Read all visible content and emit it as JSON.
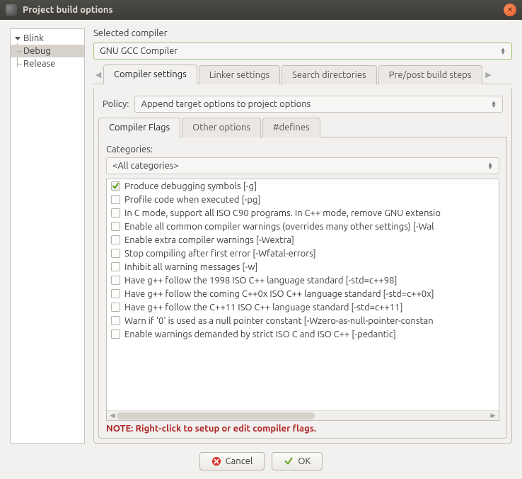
{
  "window": {
    "title": "Project build options"
  },
  "tree": {
    "root": "Blink",
    "children": [
      "Debug",
      "Release"
    ],
    "selected": "Debug"
  },
  "compiler_section": {
    "label": "Selected compiler",
    "value": "GNU GCC Compiler"
  },
  "main_tabs": {
    "items": [
      "Compiler settings",
      "Linker settings",
      "Search directories",
      "Pre/post build steps"
    ],
    "active": 0
  },
  "policy": {
    "label": "Policy:",
    "value": "Append target options to project options"
  },
  "sub_tabs": {
    "items": [
      "Compiler Flags",
      "Other options",
      "#defines"
    ],
    "active": 0
  },
  "categories": {
    "label": "Categories:",
    "value": "<All categories>"
  },
  "flags": [
    {
      "checked": true,
      "label": "Produce debugging symbols  [-g]"
    },
    {
      "checked": false,
      "label": "Profile code when executed  [-pg]"
    },
    {
      "checked": false,
      "label": "In C mode, support all ISO C90 programs. In C++ mode, remove GNU extensio"
    },
    {
      "checked": false,
      "label": "Enable all common compiler warnings (overrides many other settings)  [-Wal"
    },
    {
      "checked": false,
      "label": "Enable extra compiler warnings  [-Wextra]"
    },
    {
      "checked": false,
      "label": "Stop compiling after first error  [-Wfatal-errors]"
    },
    {
      "checked": false,
      "label": "Inhibit all warning messages  [-w]"
    },
    {
      "checked": false,
      "label": "Have g++ follow the 1998 ISO C++ language standard  [-std=c++98]"
    },
    {
      "checked": false,
      "label": "Have g++ follow the coming C++0x ISO C++ language standard  [-std=c++0x]"
    },
    {
      "checked": false,
      "label": "Have g++ follow the C++11 ISO C++ language standard  [-std=c++11]"
    },
    {
      "checked": false,
      "label": "Warn if '0' is used as a null pointer constant  [-Wzero-as-null-pointer-constan"
    },
    {
      "checked": false,
      "label": "Enable warnings demanded by strict ISO C and ISO C++  [-pedantic]"
    }
  ],
  "note": "NOTE: Right-click to setup or edit compiler flags.",
  "buttons": {
    "cancel": "Cancel",
    "ok": "OK"
  }
}
